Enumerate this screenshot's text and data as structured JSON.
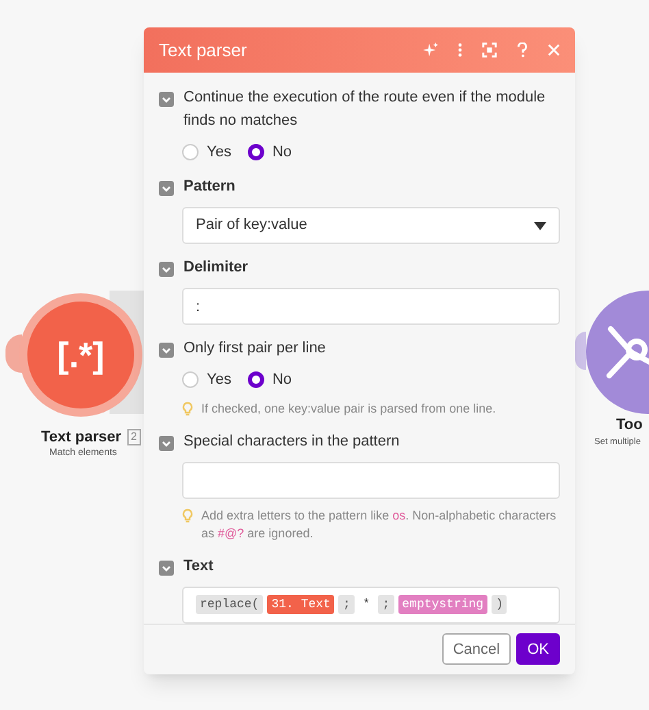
{
  "canvas": {
    "nodes": [
      {
        "kind": "parser",
        "title": "Text parser",
        "badge": "2",
        "subtitle": "Match elements",
        "icon": "[.*]"
      },
      {
        "kind": "tools",
        "title": "Too",
        "subtitle": "Set multiple"
      }
    ]
  },
  "dialog": {
    "title": "Text parser",
    "header_buttons": [
      {
        "kind": "sparkle"
      },
      {
        "kind": "more"
      },
      {
        "kind": "expand"
      },
      {
        "kind": "help"
      },
      {
        "kind": "close"
      }
    ],
    "fields": [
      {
        "kind": "radio",
        "label": "Continue the execution of the route even if the module finds no matches",
        "bold": false,
        "options": [
          {
            "label": "Yes",
            "selected": false
          },
          {
            "label": "No",
            "selected": true
          }
        ]
      },
      {
        "kind": "select",
        "label": "Pattern",
        "bold": true,
        "value": "Pair of key:value"
      },
      {
        "kind": "input",
        "label": "Delimiter",
        "bold": true,
        "value": ":"
      },
      {
        "kind": "radio",
        "label": "Only first pair per line",
        "bold": false,
        "options": [
          {
            "label": "Yes",
            "selected": false
          },
          {
            "label": "No",
            "selected": true
          }
        ],
        "hint": [
          {
            "text": "If checked, one key:value pair is parsed from one line.",
            "code": false
          }
        ]
      },
      {
        "kind": "input",
        "label": "Special characters in the pattern",
        "bold": false,
        "hint": [
          {
            "text": "Add extra letters to the pattern like ",
            "code": false
          },
          {
            "text": "os",
            "code": true
          },
          {
            "text": ". Non-alphabetic characters as ",
            "code": false
          },
          {
            "text": "#@?",
            "code": true
          },
          {
            "text": " are ignored.",
            "code": false
          }
        ]
      },
      {
        "kind": "formula",
        "label": "Text",
        "bold": true,
        "tokens": [
          {
            "kind": "function",
            "text": "replace("
          },
          {
            "kind": "item",
            "text": "31. Text"
          },
          {
            "kind": "separator",
            "text": ";"
          },
          {
            "kind": "plain",
            "text": "*"
          },
          {
            "kind": "separator",
            "text": ";"
          },
          {
            "kind": "keyword",
            "text": "emptystring"
          },
          {
            "kind": "separator",
            "text": ")"
          }
        ]
      }
    ],
    "buttons": [
      {
        "kind": "secondary",
        "label": "Cancel"
      },
      {
        "kind": "primary",
        "label": "OK"
      }
    ]
  }
}
